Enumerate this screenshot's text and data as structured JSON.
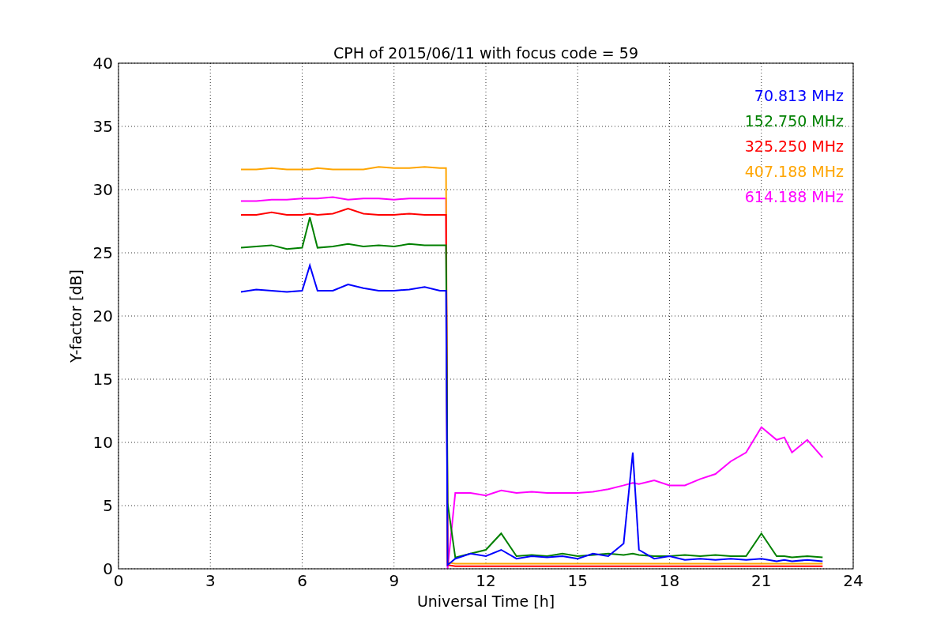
{
  "figure": {
    "chart_data": {
      "type": "line",
      "title": "CPH of 2015/06/11 with focus code = 59",
      "xlabel": "Universal Time [h]",
      "ylabel": "Y-factor [dB]",
      "x": [
        4,
        4.5,
        5,
        5.5,
        6,
        6.25,
        6.5,
        7,
        7.5,
        8,
        8.5,
        9,
        9.5,
        10,
        10.5,
        10.7,
        10.75,
        11,
        11.5,
        12,
        12.5,
        13,
        13.5,
        14,
        14.5,
        15,
        15.5,
        16,
        16.5,
        16.8,
        17,
        17.5,
        18,
        18.5,
        19,
        19.5,
        20,
        20.5,
        21,
        21.5,
        21.75,
        22,
        22.5,
        23
      ],
      "series": [
        {
          "name": "70.813 MHz",
          "color": "#0000ff",
          "values": [
            21.9,
            22.1,
            22,
            21.9,
            22,
            24,
            22,
            22,
            22.5,
            22.2,
            22,
            22,
            22.1,
            22.3,
            22,
            22,
            0.3,
            0.8,
            1.2,
            1,
            1.5,
            0.8,
            1,
            0.9,
            1,
            0.8,
            1.2,
            1,
            2,
            9.2,
            1.5,
            0.8,
            1,
            0.7,
            0.8,
            0.7,
            0.8,
            0.7,
            0.8,
            0.6,
            0.7,
            0.6,
            0.7,
            0.6
          ]
        },
        {
          "name": "152.750 MHz",
          "color": "#008000",
          "values": [
            25.4,
            25.5,
            25.6,
            25.3,
            25.4,
            27.8,
            25.4,
            25.5,
            25.7,
            25.5,
            25.6,
            25.5,
            25.7,
            25.6,
            25.6,
            25.6,
            5.2,
            0.9,
            1.2,
            1.5,
            2.8,
            1,
            1.1,
            1,
            1.2,
            1,
            1.1,
            1.2,
            1.1,
            1.2,
            1.1,
            1,
            1,
            1.1,
            1,
            1.1,
            1,
            1,
            2.8,
            1,
            1,
            0.9,
            1,
            0.9
          ]
        },
        {
          "name": "325.250 MHz",
          "color": "#ff0000",
          "values": [
            28,
            28,
            28.2,
            28,
            28,
            28.1,
            28,
            28.1,
            28.5,
            28.1,
            28,
            28,
            28.1,
            28,
            28,
            28,
            0.3,
            0.2,
            0.2,
            0.2,
            0.2,
            0.2,
            0.2,
            0.2,
            0.2,
            0.2,
            0.2,
            0.2,
            0.2,
            0.2,
            0.2,
            0.2,
            0.2,
            0.2,
            0.2,
            0.2,
            0.2,
            0.2,
            0.2,
            0.2,
            0.2,
            0.2,
            0.2,
            0.2
          ]
        },
        {
          "name": "407.188 MHz",
          "color": "#ffa500",
          "values": [
            31.6,
            31.6,
            31.7,
            31.6,
            31.6,
            31.6,
            31.7,
            31.6,
            31.6,
            31.6,
            31.8,
            31.7,
            31.7,
            31.8,
            31.7,
            31.7,
            0.5,
            0.4,
            0.4,
            0.4,
            0.4,
            0.4,
            0.4,
            0.4,
            0.4,
            0.4,
            0.4,
            0.4,
            0.4,
            0.4,
            0.4,
            0.4,
            0.4,
            0.4,
            0.4,
            0.4,
            0.4,
            0.4,
            0.4,
            0.4,
            0.4,
            0.4,
            0.4,
            0.4
          ]
        },
        {
          "name": "614.188 MHz",
          "color": "#ff00ff",
          "values": [
            29.1,
            29.1,
            29.2,
            29.2,
            29.3,
            29.3,
            29.3,
            29.4,
            29.2,
            29.3,
            29.3,
            29.2,
            29.3,
            29.3,
            29.3,
            29.3,
            0,
            6,
            6,
            5.8,
            6.2,
            6,
            6.1,
            6,
            6,
            6,
            6.1,
            6.3,
            6.6,
            6.8,
            6.7,
            7,
            6.6,
            6.6,
            7.1,
            7.5,
            8.5,
            9.2,
            11.2,
            10.2,
            10.4,
            9.2,
            10.2,
            8.8
          ]
        }
      ],
      "grid": true,
      "xlim": [
        0,
        24
      ],
      "ylim": [
        0,
        40
      ],
      "xticks": [
        0,
        3,
        6,
        9,
        12,
        15,
        18,
        21,
        24
      ],
      "yticks": [
        0,
        5,
        10,
        15,
        20,
        25,
        30,
        35,
        40
      ]
    }
  }
}
